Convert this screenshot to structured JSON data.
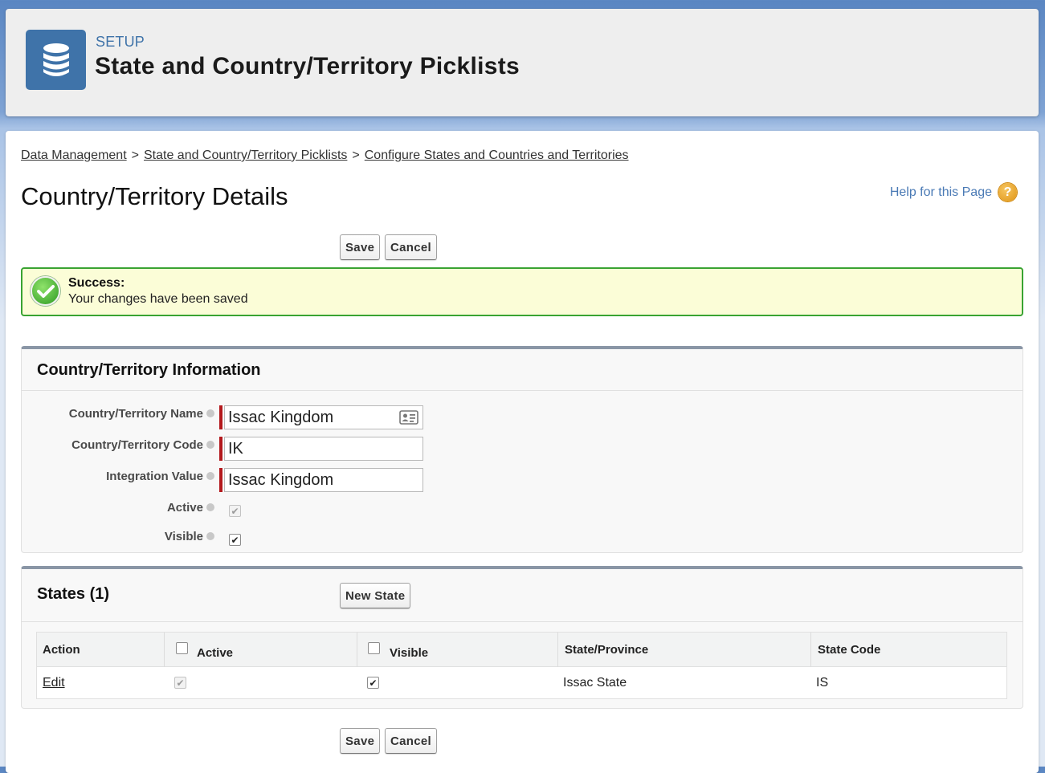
{
  "setup_header": {
    "label": "SETUP",
    "title": "State and Country/Territory Picklists",
    "icon": "database-icon"
  },
  "breadcrumb": {
    "items": [
      "Data Management",
      "State and Country/Territory Picklists",
      "Configure States and Countries and Territories"
    ],
    "separator": ">"
  },
  "page": {
    "title": "Country/Territory Details",
    "help_link": "Help for this Page",
    "help_icon_glyph": "?"
  },
  "buttons": {
    "save": "Save",
    "cancel": "Cancel",
    "new_state": "New State"
  },
  "success": {
    "title": "Success:",
    "message": "Your changes have been saved",
    "color": "#39a332"
  },
  "info_section": {
    "title": "Country/Territory Information",
    "fields": {
      "name": {
        "label": "Country/Territory Name",
        "value": "Issac Kingdom"
      },
      "code": {
        "label": "Country/Territory Code",
        "value": "IK"
      },
      "integration": {
        "label": "Integration Value",
        "value": "Issac Kingdom"
      },
      "active": {
        "label": "Active",
        "checked": true,
        "disabled": true
      },
      "visible": {
        "label": "Visible",
        "checked": true,
        "disabled": false
      }
    }
  },
  "states_section": {
    "title": "States (1)",
    "columns": [
      "Action",
      "Active",
      "Visible",
      "State/Province",
      "State Code"
    ],
    "rows": [
      {
        "action": "Edit",
        "active": true,
        "visible": true,
        "state": "Issac State",
        "code": "IS"
      }
    ]
  },
  "colors": {
    "brand_blue": "#3f73a9",
    "required": "#b3181c",
    "link": "#4a7ab5"
  }
}
